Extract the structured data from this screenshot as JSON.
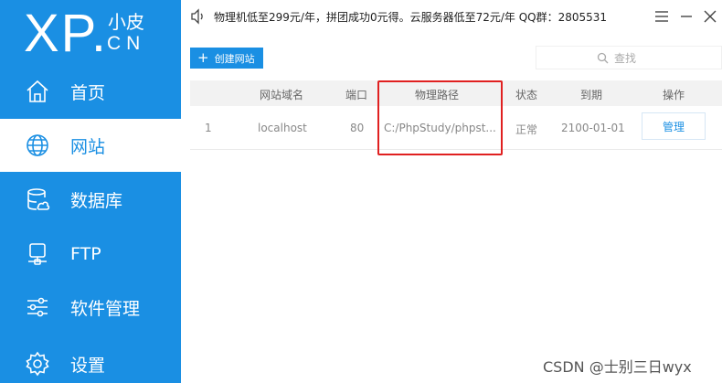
{
  "logo": {
    "main": "XP.",
    "small": "小皮",
    "sub": "CN"
  },
  "sidebar": {
    "items": [
      {
        "label": "首页",
        "icon": "home-icon"
      },
      {
        "label": "网站",
        "icon": "globe-icon",
        "active": true
      },
      {
        "label": "数据库",
        "icon": "database-icon"
      },
      {
        "label": "FTP",
        "icon": "ftp-server-icon"
      },
      {
        "label": "软件管理",
        "icon": "sliders-icon"
      },
      {
        "label": "设置",
        "icon": "gear-icon"
      }
    ]
  },
  "topbar": {
    "notice": "物理机低至299元/年，拼团成功0元得。云服务器低至72元/年  QQ群：2805531"
  },
  "toolbar": {
    "create_label": "创建网站",
    "search_placeholder": "查找"
  },
  "table": {
    "headers": [
      "网站域名",
      "端口",
      "物理路径",
      "状态",
      "到期",
      "操作"
    ],
    "rows": [
      {
        "index": "1",
        "domain": "localhost",
        "port": "80",
        "path": "C:/PhpStudy/phpst...",
        "status": "正常",
        "expiry": "2100-01-01",
        "action": "管理"
      }
    ]
  },
  "watermark": "CSDN @士别三日wyx",
  "colors": {
    "accent": "#1a8fe3",
    "highlight": "#e02020"
  }
}
